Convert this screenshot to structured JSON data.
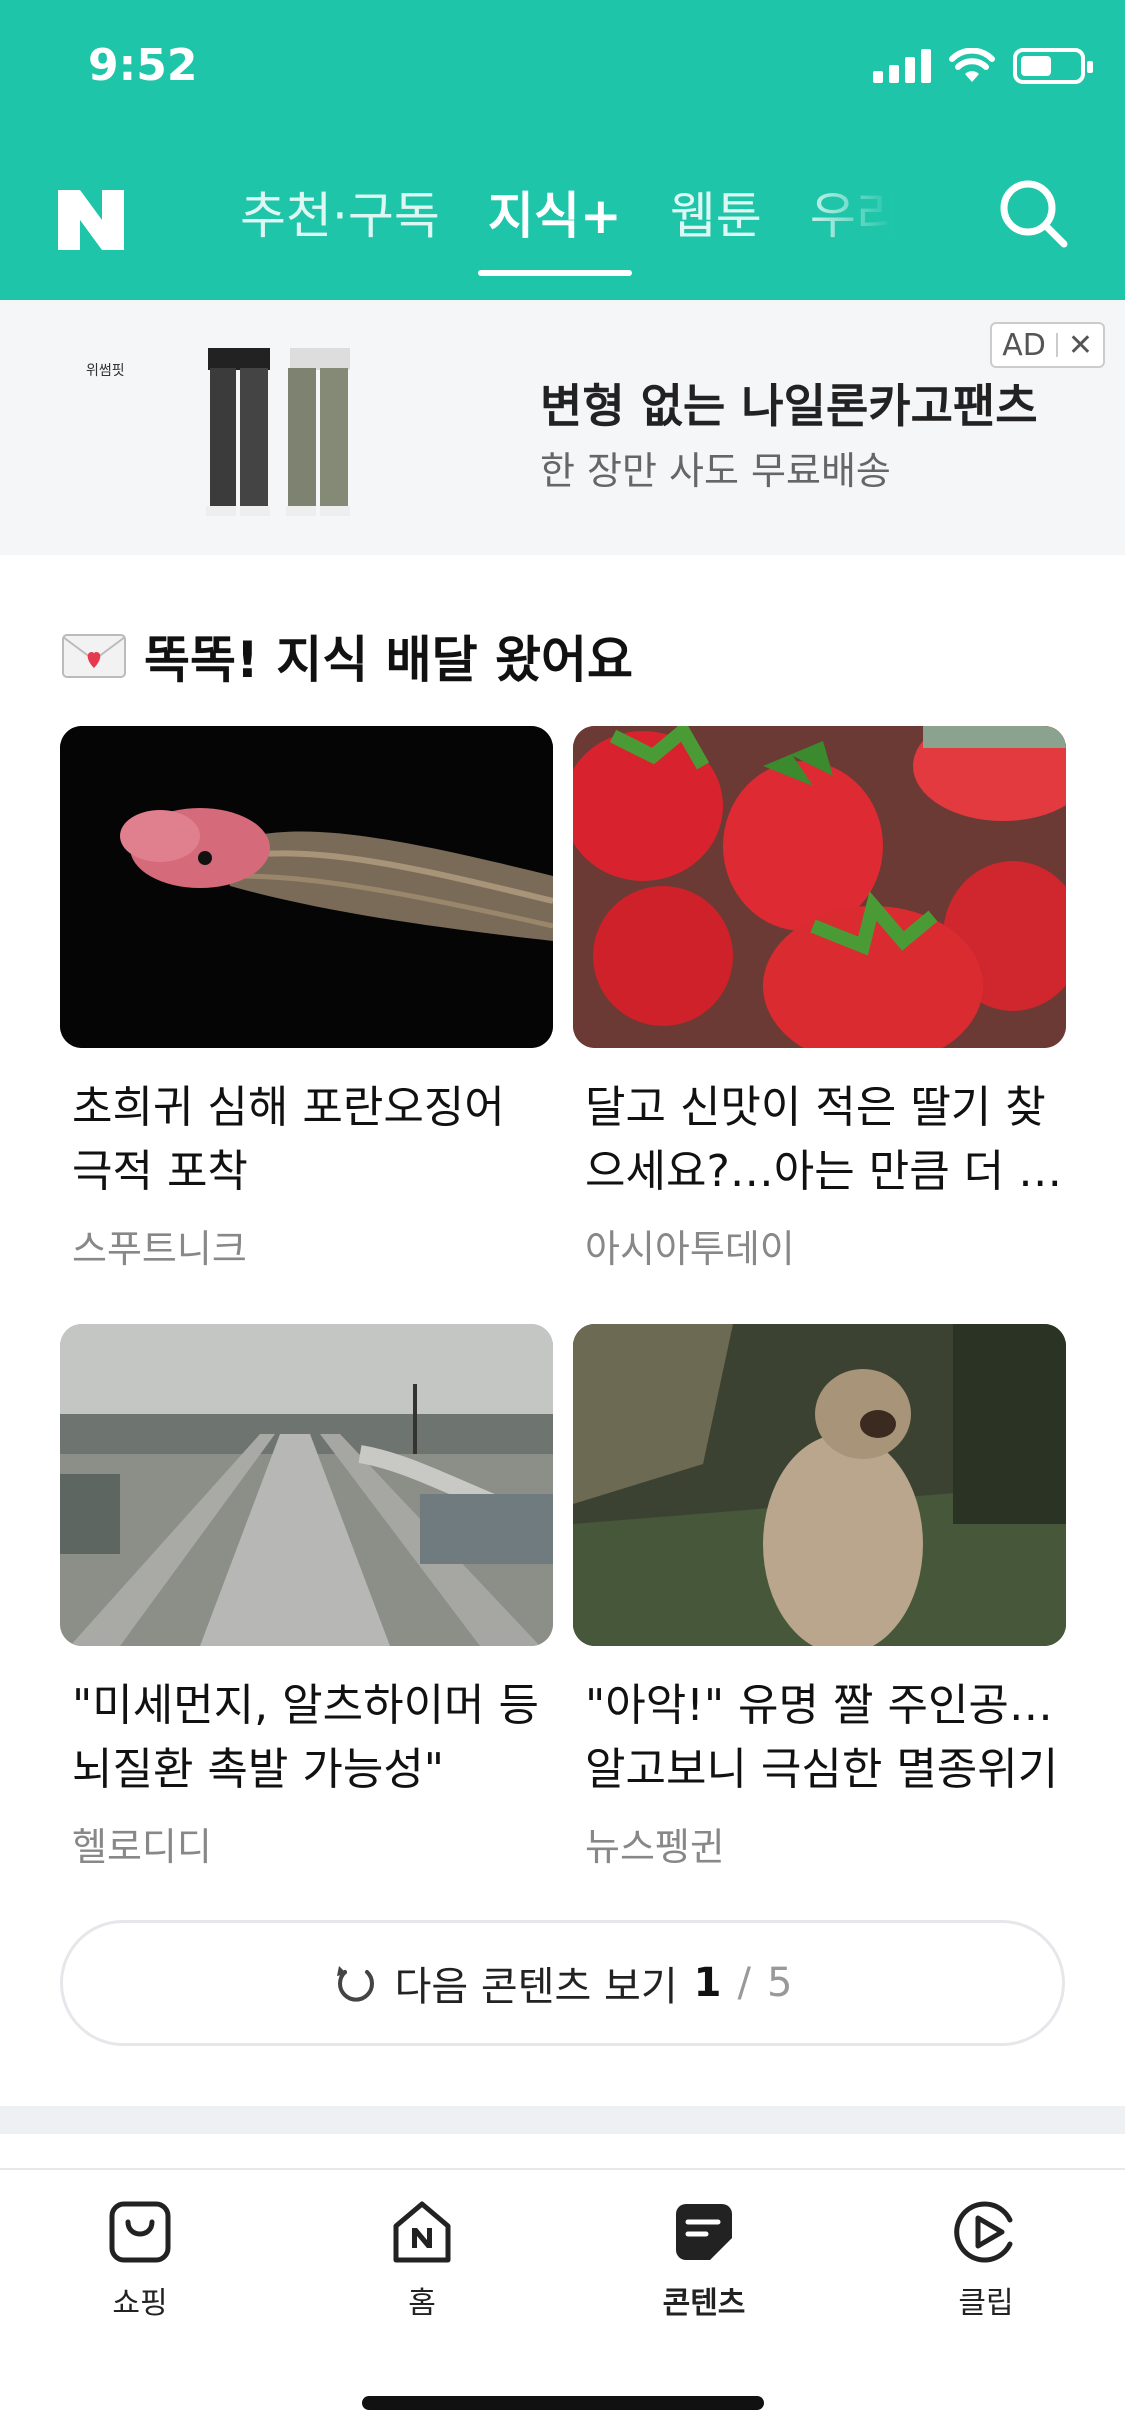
{
  "status_bar": {
    "time": "9:52"
  },
  "header": {
    "logo": "N",
    "tabs": [
      {
        "label": "추천·구독",
        "active": false
      },
      {
        "label": "지식+",
        "active": true
      },
      {
        "label": "웹툰",
        "active": false
      },
      {
        "label": "우리동",
        "active": false
      }
    ],
    "search_icon": "search-icon",
    "brand_color": "#1ec5a9"
  },
  "ad": {
    "brand": "위썸핏",
    "title": "변형 없는 나일론카고팬츠",
    "subtitle": "한 장만 사도 무료배송",
    "badge": "AD",
    "close": "✕"
  },
  "section": {
    "title": "똑똑! 지식 배달 왔어요",
    "cards": [
      {
        "title": "초희귀 심해 포란오징어 극적 포착",
        "source": "스푸트니크"
      },
      {
        "title": "달고 신맛이 적은 딸기 찾으세요?…아는 만큼 더 …",
        "source": "아시아투데이"
      },
      {
        "title": "\"미세먼지, 알츠하이머 등 뇌질환 촉발 가능성\"",
        "source": "헬로디디"
      },
      {
        "title": "\"아악!\" 유명 짤 주인공… 알고보니 극심한 멸종위기",
        "source": "뉴스펭귄"
      }
    ],
    "more_button": {
      "label": "다음 콘텐츠 보기",
      "current": "1",
      "total": "5"
    }
  },
  "tabbar": {
    "items": [
      {
        "label": "쇼핑",
        "icon": "shopping-bag-icon"
      },
      {
        "label": "홈",
        "icon": "home-icon"
      },
      {
        "label": "콘텐츠",
        "icon": "contents-icon",
        "active": true
      },
      {
        "label": "클립",
        "icon": "clip-play-icon"
      }
    ]
  }
}
